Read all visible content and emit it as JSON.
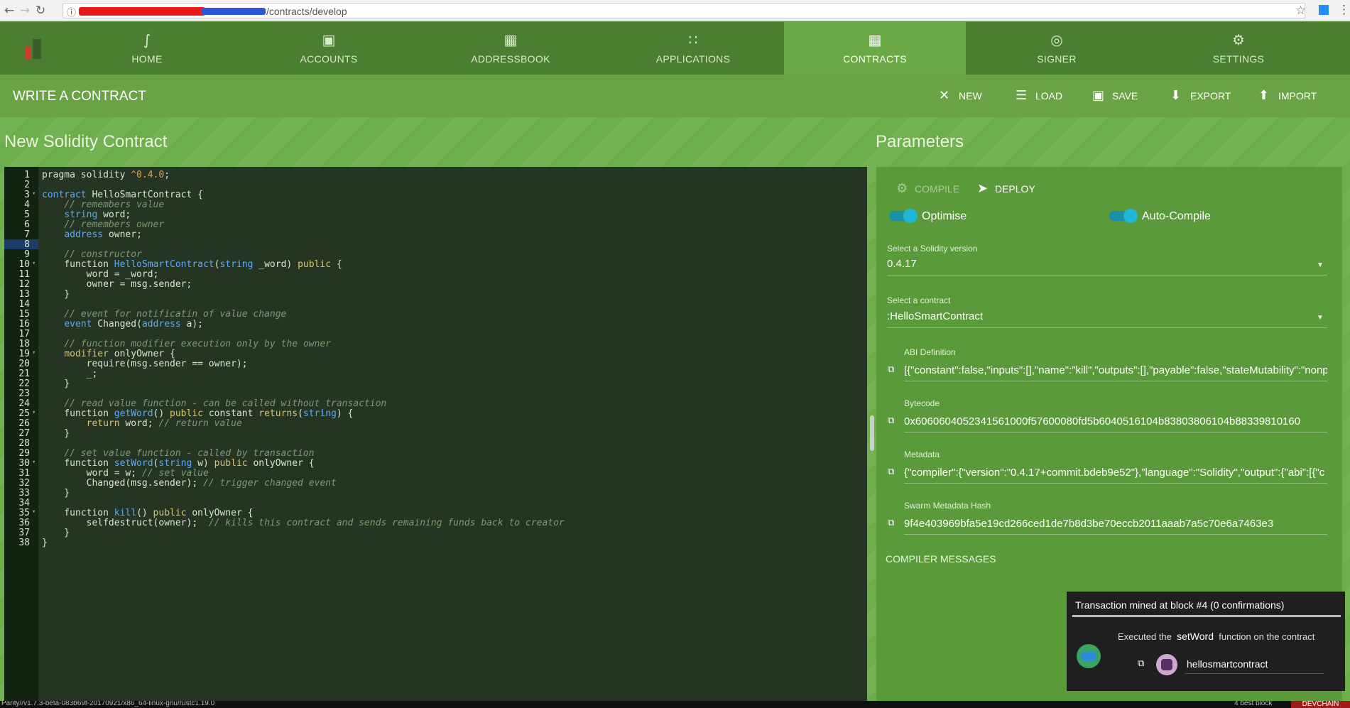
{
  "browser": {
    "url_path": "/contracts/develop"
  },
  "nav": {
    "tabs": [
      {
        "label": "HOME",
        "icon": "parity-logo-icon"
      },
      {
        "label": "ACCOUNTS",
        "icon": "wallet-icon"
      },
      {
        "label": "ADDRESSBOOK",
        "icon": "addressbook-icon"
      },
      {
        "label": "APPLICATIONS",
        "icon": "grid-icon"
      },
      {
        "label": "CONTRACTS",
        "icon": "contracts-icon",
        "active": true
      },
      {
        "label": "SIGNER",
        "icon": "fingerprint-icon"
      },
      {
        "label": "SETTINGS",
        "icon": "gear-icon"
      }
    ]
  },
  "toolbar": {
    "title": "WRITE A CONTRACT",
    "new": "NEW",
    "load": "LOAD",
    "save": "SAVE",
    "export": "EXPORT",
    "import": "IMPORT"
  },
  "editor": {
    "heading": "New Solidity Contract",
    "active_line": 8,
    "lines": [
      "pragma solidity ^0.4.0;",
      "",
      "contract HelloSmartContract {",
      "    // remembers value",
      "    string word;",
      "    // remembers owner",
      "    address owner;",
      "",
      "    // constructor",
      "    function HelloSmartContract(string _word) public {",
      "        word = _word;",
      "        owner = msg.sender;",
      "    }",
      "",
      "    // event for notificatin of value change",
      "    event Changed(address a);",
      "",
      "    // function modifier execution only by the owner",
      "    modifier onlyOwner {",
      "        require(msg.sender == owner);",
      "        _;",
      "    }",
      "",
      "    // read value function - can be called without transaction",
      "    function getWord() public constant returns(string) {",
      "        return word; // return value",
      "    }",
      "",
      "    // set value function - called by transaction",
      "    function setWord(string w) public onlyOwner {",
      "        word = w; // set value",
      "        Changed(msg.sender); // trigger changed event",
      "    }",
      "",
      "    function kill() public onlyOwner {",
      "        selfdestruct(owner);  // kills this contract and sends remaining funds back to creator",
      "    }",
      "}"
    ],
    "fold_lines": [
      3,
      10,
      19,
      25,
      30,
      35
    ]
  },
  "params": {
    "heading": "Parameters",
    "compile": "COMPILE",
    "deploy": "DEPLOY",
    "optimise": "Optimise",
    "optimise_on": true,
    "autocompile": "Auto-Compile",
    "autocompile_on": true,
    "version_label": "Select a Solidity version",
    "version_value": "0.4.17",
    "contract_label": "Select a contract",
    "contract_value": ":HelloSmartContract",
    "abi_label": "ABI Definition",
    "abi_value": "[{\"constant\":false,\"inputs\":[],\"name\":\"kill\",\"outputs\":[],\"payable\":false,\"stateMutability\":\"nonp",
    "bytecode_label": "Bytecode",
    "bytecode_value": "0x6060604052341561000f57600080fd5b6040516104b83803806104b88339810160",
    "metadata_label": "Metadata",
    "metadata_value": "{\"compiler\":{\"version\":\"0.4.17+commit.bdeb9e52\"},\"language\":\"Solidity\",\"output\":{\"abi\":[{\"c",
    "swarm_label": "Swarm Metadata Hash",
    "swarm_value": "9f4e403969bfa5e19cd266ced1de7b8d3be70eccb2011aaab7a5c70e6a7463e3",
    "compiler_messages": "COMPILER MESSAGES"
  },
  "toast": {
    "header": "Transaction mined at block #4 (0 confirmations)",
    "executed_prefix": "Executed the",
    "function_name": "setWord",
    "executed_suffix": "function on the contract",
    "contract_name": "hellosmartcontract"
  },
  "status": {
    "version": "Parity//v1.7.3-beta-083b69f-20170921/x86_64-linux-gnu/rustc1.19.0",
    "best_block": "4 best block",
    "chain": "DEVCHAIN"
  }
}
